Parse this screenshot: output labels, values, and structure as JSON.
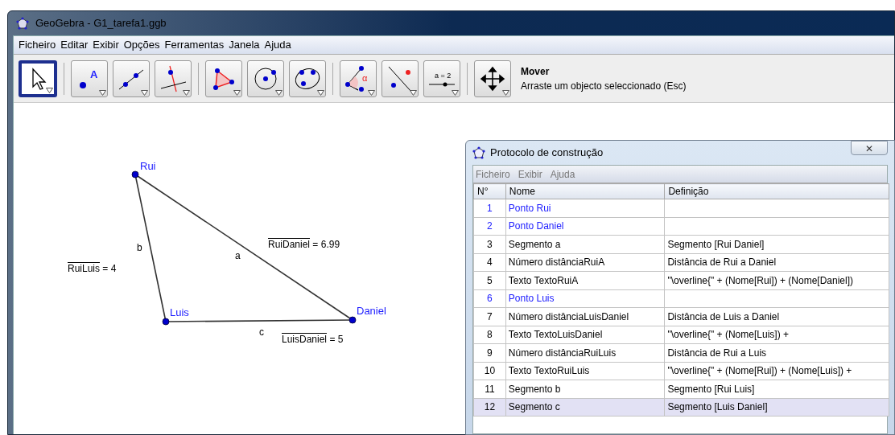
{
  "window": {
    "title": "GeoGebra - G1_tarefa1.ggb"
  },
  "menu": [
    "Ficheiro",
    "Editar",
    "Exibir",
    "Opções",
    "Ferramentas",
    "Janela",
    "Ajuda"
  ],
  "toolbar": {
    "groups": [
      [
        {
          "kind": "move",
          "selected": true
        }
      ],
      [
        {
          "kind": "point",
          "label": "A",
          "selected": false
        },
        {
          "kind": "line",
          "selected": false
        },
        {
          "kind": "perpendicular",
          "selected": false
        }
      ],
      [
        {
          "kind": "polygon",
          "selected": false
        },
        {
          "kind": "circle",
          "selected": false
        },
        {
          "kind": "conic",
          "selected": false
        }
      ],
      [
        {
          "kind": "angle",
          "label": "α",
          "selected": false
        },
        {
          "kind": "reflect",
          "selected": false
        },
        {
          "kind": "slider",
          "label": "a = 2",
          "selected": false
        }
      ],
      [
        {
          "kind": "move-view",
          "selected": false
        }
      ]
    ],
    "tool_name": "Mover",
    "tool_help": "Arraste um objecto seleccionado (Esc)"
  },
  "canvas": {
    "points": [
      {
        "label": "Rui"
      },
      {
        "label": "Luis"
      },
      {
        "label": "Daniel"
      }
    ],
    "segments": [
      {
        "label": "a"
      },
      {
        "label": "b"
      },
      {
        "label": "c"
      }
    ],
    "texts": [
      {
        "segment": "RuiDaniel",
        "value": " = 6.99"
      },
      {
        "segment": "RuiLuis",
        "value": " = 4"
      },
      {
        "segment": "LuisDaniel",
        "value": " = 5"
      }
    ]
  },
  "protocol": {
    "title": "Protocolo de construção",
    "close": "✕",
    "menu": [
      "Ficheiro",
      "Exibir",
      "Ajuda"
    ],
    "columns": [
      "N°",
      "Nome",
      "Definição"
    ],
    "rows": [
      {
        "n": "1",
        "name": "Ponto Rui",
        "definition": "",
        "kind": "point",
        "selected": false
      },
      {
        "n": "2",
        "name": "Ponto Daniel",
        "definition": "",
        "kind": "point",
        "selected": false
      },
      {
        "n": "3",
        "name": "Segmento a",
        "definition": "Segmento [Rui Daniel]",
        "kind": "object",
        "selected": false
      },
      {
        "n": "4",
        "name": "Número distânciaRuiA",
        "definition": "Distância de Rui a Daniel",
        "kind": "object",
        "selected": false
      },
      {
        "n": "5",
        "name": "Texto TextoRuiA",
        "definition": "\"\\overline{\" + (Nome[Rui]) + (Nome[Daniel])",
        "kind": "object",
        "selected": false
      },
      {
        "n": "6",
        "name": "Ponto Luis",
        "definition": "",
        "kind": "point",
        "selected": false
      },
      {
        "n": "7",
        "name": "Número distânciaLuisDaniel",
        "definition": "Distância de Luis a Daniel",
        "kind": "object",
        "selected": false
      },
      {
        "n": "8",
        "name": "Texto TextoLuisDaniel",
        "definition": "\"\\overline{\" + (Nome[Luis]) +",
        "kind": "object",
        "selected": false
      },
      {
        "n": "9",
        "name": "Número distânciaRuiLuis",
        "definition": "Distância de Rui a Luis",
        "kind": "object",
        "selected": false
      },
      {
        "n": "10",
        "name": "Texto TextoRuiLuis",
        "definition": "\"\\overline{\" + (Nome[Rui]) + (Nome[Luis]) +",
        "kind": "object",
        "selected": false
      },
      {
        "n": "11",
        "name": "Segmento b",
        "definition": "Segmento [Rui Luis]",
        "kind": "object",
        "selected": false
      },
      {
        "n": "12",
        "name": "Segmento c",
        "definition": "Segmento [Luis Daniel]",
        "kind": "object",
        "selected": true
      }
    ]
  }
}
